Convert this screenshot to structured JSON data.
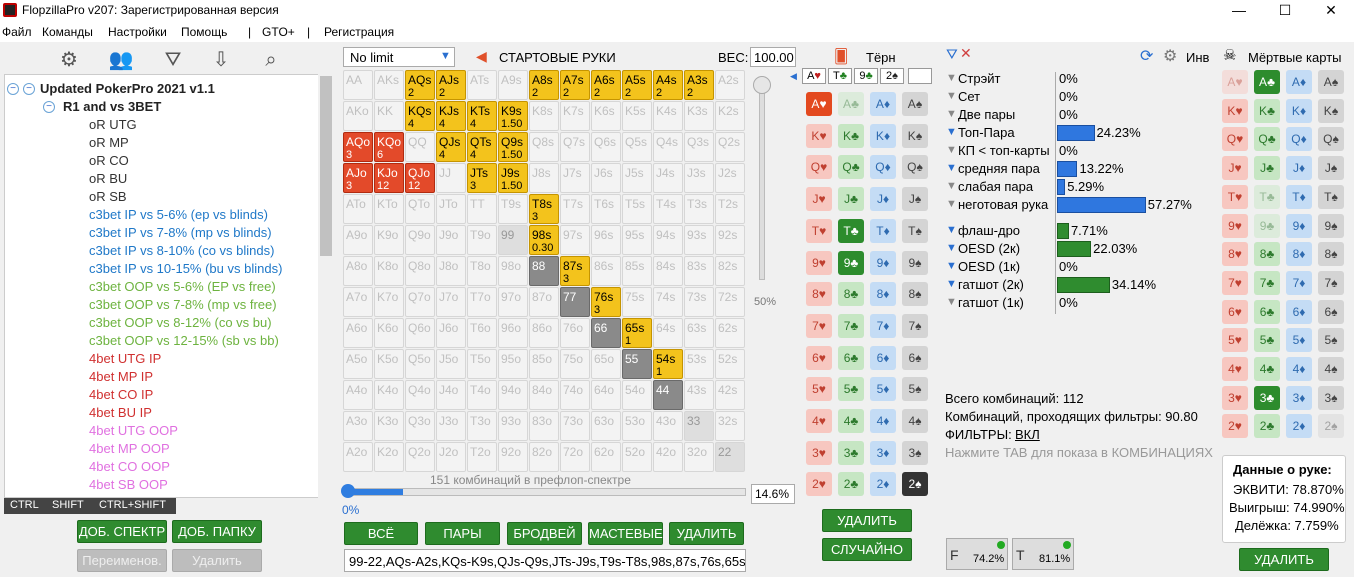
{
  "window": {
    "title": "FlopzillaPro v207: Зарегистрированная версия",
    "minimize": "—",
    "maximize": "☐",
    "close": "✕"
  },
  "menu": [
    "Файл",
    "Команды",
    "Настройки",
    "Помощь",
    "|",
    "GTO+",
    "|",
    "Регистрация"
  ],
  "toolbar_icons": [
    "gear-icon",
    "users-icon",
    "filter-icon",
    "import-icon",
    "search-icon"
  ],
  "tree": {
    "root": "Updated PokerPro 2021 v1.1",
    "group": "R1 and vs 3BET",
    "items": [
      {
        "t": "oR UTG",
        "c": "#333333"
      },
      {
        "t": "oR MP",
        "c": "#333333"
      },
      {
        "t": "oR CO",
        "c": "#333333"
      },
      {
        "t": "oR BU",
        "c": "#333333"
      },
      {
        "t": "oR SB",
        "c": "#333333"
      },
      {
        "t": "c3bet IP vs 5-6% (ep vs blinds)",
        "c": "#1f78c8"
      },
      {
        "t": "c3bet IP vs 7-8% (mp vs blinds)",
        "c": "#1f78c8"
      },
      {
        "t": "c3bet IP vs 8-10% (co vs blinds)",
        "c": "#1f78c8"
      },
      {
        "t": "c3bet IP vs 10-15% (bu vs blinds)",
        "c": "#1f78c8"
      },
      {
        "t": "c3bet OOP vs 5-6% (EP vs free)",
        "c": "#6db33f"
      },
      {
        "t": "c3bet OOP vs 7-8% (mp vs free)",
        "c": "#6db33f"
      },
      {
        "t": "c3bet OOP vs 8-12% (co vs bu)",
        "c": "#6db33f"
      },
      {
        "t": "c3bet OOP vs 12-15% (sb vs bb)",
        "c": "#6db33f"
      },
      {
        "t": "4bet UTG IP",
        "c": "#d03030"
      },
      {
        "t": "4bet MP IP",
        "c": "#d03030"
      },
      {
        "t": "4bet CO IP",
        "c": "#d03030"
      },
      {
        "t": "4bet BU IP",
        "c": "#d03030"
      },
      {
        "t": "4bet UTG OOP",
        "c": "#e070e0"
      },
      {
        "t": "4bet MP OOP",
        "c": "#e070e0"
      },
      {
        "t": "4bet CO OOP",
        "c": "#e070e0"
      },
      {
        "t": "4bet SB OOP",
        "c": "#e070e0"
      }
    ]
  },
  "modkeys": [
    "CTRL",
    "SHIFT",
    "CTRL+SHIFT"
  ],
  "left_buttons": {
    "add_range": "ДОБ. СПЕКТР",
    "add_folder": "ДОБ. ПАПКУ",
    "rename": "Переименов.",
    "delete": "Удалить"
  },
  "range": {
    "game": "No limit",
    "label": "СТАРТОВЫЕ РУКИ",
    "weight_label": "ВЕС:",
    "weight": "100.00",
    "slider_pct": "50%",
    "combos_text": "151 комбинаций в префлоп-спектре",
    "progress_pct": "14.6%",
    "progress_left": "0%",
    "progress_value": 0.146,
    "buttons": [
      "ВСЁ",
      "ПАРЫ",
      "БРОДВЕЙ",
      "МАСТЕВЫЕ",
      "УДАЛИТЬ"
    ],
    "text": "99-22,AQs-A2s,KQs-K9s,QJs-Q9s,JTs-J9s,T9s-T8s,98s,87s,76s,65s,5"
  },
  "grid": [
    [
      "AA",
      "AKs",
      "AQs",
      "AJs",
      "ATs",
      "A9s",
      "A8s",
      "A7s",
      "A6s",
      "A5s",
      "A4s",
      "A3s",
      "A2s"
    ],
    [
      "AKo",
      "KK",
      "KQs",
      "KJs",
      "KTs",
      "K9s",
      "K8s",
      "K7s",
      "K6s",
      "K5s",
      "K4s",
      "K3s",
      "K2s"
    ],
    [
      "AQo",
      "KQo",
      "QQ",
      "QJs",
      "QTs",
      "Q9s",
      "Q8s",
      "Q7s",
      "Q6s",
      "Q5s",
      "Q4s",
      "Q3s",
      "Q2s"
    ],
    [
      "AJo",
      "KJo",
      "QJo",
      "JJ",
      "JTs",
      "J9s",
      "J8s",
      "J7s",
      "J6s",
      "J5s",
      "J4s",
      "J3s",
      "J2s"
    ],
    [
      "ATo",
      "KTo",
      "QTo",
      "JTo",
      "TT",
      "T9s",
      "T8s",
      "T7s",
      "T6s",
      "T5s",
      "T4s",
      "T3s",
      "T2s"
    ],
    [
      "A9o",
      "K9o",
      "Q9o",
      "J9o",
      "T9o",
      "99",
      "98s",
      "97s",
      "96s",
      "95s",
      "94s",
      "93s",
      "92s"
    ],
    [
      "A8o",
      "K8o",
      "Q8o",
      "J8o",
      "T8o",
      "98o",
      "88",
      "87s",
      "86s",
      "85s",
      "84s",
      "83s",
      "82s"
    ],
    [
      "A7o",
      "K7o",
      "Q7o",
      "J7o",
      "T7o",
      "97o",
      "87o",
      "77",
      "76s",
      "75s",
      "74s",
      "73s",
      "72s"
    ],
    [
      "A6o",
      "K6o",
      "Q6o",
      "J6o",
      "T6o",
      "96o",
      "86o",
      "76o",
      "66",
      "65s",
      "64s",
      "63s",
      "62s"
    ],
    [
      "A5o",
      "K5o",
      "Q5o",
      "J5o",
      "T5o",
      "95o",
      "85o",
      "75o",
      "65o",
      "55",
      "54s",
      "53s",
      "52s"
    ],
    [
      "A4o",
      "K4o",
      "Q4o",
      "J4o",
      "T4o",
      "94o",
      "84o",
      "74o",
      "64o",
      "54o",
      "44",
      "43s",
      "42s"
    ],
    [
      "A3o",
      "K3o",
      "Q3o",
      "J3o",
      "T3o",
      "93o",
      "83o",
      "73o",
      "63o",
      "53o",
      "43o",
      "33",
      "32s"
    ],
    [
      "A2o",
      "K2o",
      "Q2o",
      "J2o",
      "T2o",
      "92o",
      "82o",
      "72o",
      "62o",
      "52o",
      "42o",
      "32o",
      "22"
    ]
  ],
  "grid_state": {
    "AQs": [
      "y",
      "2"
    ],
    "AJs": [
      "y",
      "2"
    ],
    "A8s": [
      "y",
      "2"
    ],
    "A7s": [
      "y",
      "2"
    ],
    "A6s": [
      "y",
      "2"
    ],
    "A5s": [
      "y",
      "2"
    ],
    "A4s": [
      "y",
      "2"
    ],
    "A3s": [
      "y",
      "2"
    ],
    "KQs": [
      "y",
      "4"
    ],
    "KJs": [
      "y",
      "4"
    ],
    "KTs": [
      "y",
      "4"
    ],
    "K9s": [
      "y",
      "1.50"
    ],
    "QJs": [
      "y",
      "4"
    ],
    "QTs": [
      "y",
      "4"
    ],
    "Q9s": [
      "y",
      "1.50"
    ],
    "JTs": [
      "y",
      "3"
    ],
    "J9s": [
      "y",
      "1.50"
    ],
    "T8s": [
      "y",
      "3"
    ],
    "98s": [
      "y",
      "0.30"
    ],
    "87s": [
      "y",
      "3"
    ],
    "76s": [
      "y",
      "3"
    ],
    "65s": [
      "y",
      "1"
    ],
    "54s": [
      "y",
      "1"
    ],
    "AQo": [
      "r",
      "3"
    ],
    "KQo": [
      "r",
      "6"
    ],
    "AJo": [
      "r",
      "3"
    ],
    "KJo": [
      "r",
      "12"
    ],
    "QJo": [
      "r",
      "12"
    ],
    "99": [
      "d",
      ""
    ],
    "88": [
      "g",
      ""
    ],
    "77": [
      "g",
      ""
    ],
    "66": [
      "g",
      ""
    ],
    "55": [
      "g",
      ""
    ],
    "44": [
      "g",
      ""
    ],
    "33": [
      "d",
      ""
    ],
    "22": [
      "d",
      ""
    ]
  },
  "board": {
    "title": "Тёрн",
    "cards": [
      {
        "r": "A",
        "s": "♥",
        "c": "#c02020"
      },
      {
        "r": "T",
        "s": "♣",
        "c": "#208020"
      },
      {
        "r": "9",
        "s": "♣",
        "c": "#208020"
      },
      {
        "r": "2",
        "s": "♠",
        "c": "#222"
      }
    ],
    "ranks": [
      "A",
      "K",
      "Q",
      "J",
      "T",
      "9",
      "8",
      "7",
      "6",
      "5",
      "4",
      "3",
      "2"
    ],
    "suits": [
      "h",
      "c",
      "d",
      "s"
    ],
    "selected": [
      "Ah",
      "Tc",
      "9c",
      "2s"
    ],
    "disabled": [
      "Ac"
    ],
    "btn_delete": "УДАЛИТЬ",
    "btn_random": "СЛУЧАЙНО"
  },
  "filters": {
    "inv": "Инв",
    "rows": [
      {
        "label": "Стрэйт",
        "val": "0%",
        "pct": 0,
        "on": false
      },
      {
        "label": "Сет",
        "val": "0%",
        "pct": 0,
        "on": false
      },
      {
        "label": "Две пары",
        "val": "0%",
        "pct": 0,
        "on": false
      },
      {
        "label": "Топ-Пара",
        "val": "24.23%",
        "pct": 24.23,
        "on": true
      },
      {
        "label": "КП < топ-карты",
        "val": "0%",
        "pct": 0,
        "on": false
      },
      {
        "label": "средняя пара",
        "val": "13.22%",
        "pct": 13.22,
        "on": true
      },
      {
        "label": "слабая пара",
        "val": "5.29%",
        "pct": 5.29,
        "on": false
      },
      {
        "label": "неготовая рука",
        "val": "57.27%",
        "pct": 57.27,
        "on": false
      },
      {
        "label": "флаш-дро",
        "val": "7.71%",
        "pct": 7.71,
        "on": true
      },
      {
        "label": "OESD (2к)",
        "val": "22.03%",
        "pct": 22.03,
        "on": true
      },
      {
        "label": "OESD (1к)",
        "val": "0%",
        "pct": 0,
        "on": true
      },
      {
        "label": "гатшот (2к)",
        "val": "34.14%",
        "pct": 34.14,
        "on": true
      },
      {
        "label": "гатшот (1к)",
        "val": "0%",
        "pct": 0,
        "on": false
      }
    ],
    "total": "Всего комбинаций: 112",
    "passing": "Комбинаций, проходящих фильтры: 90.80",
    "filters_label": "ФИЛЬТРЫ:",
    "filters_state": "ВКЛ",
    "hint": "Нажмите TAB для показа в КОМБИНАЦИЯХ",
    "f_pct": "74.2%",
    "t_pct": "81.1%"
  },
  "dead": {
    "title": "Мёртвые карты",
    "selected": [
      "Ac",
      "3c"
    ],
    "disabled": [
      "Ah",
      "Tc",
      "9c",
      "2s"
    ],
    "hand_title": "Данные о руке:",
    "equity": "ЭКВИТИ: 78.870%",
    "win": "Выигрыш: 74.990%",
    "tie": "Делёжка: 7.759%",
    "btn_delete": "УДАЛИТЬ"
  }
}
